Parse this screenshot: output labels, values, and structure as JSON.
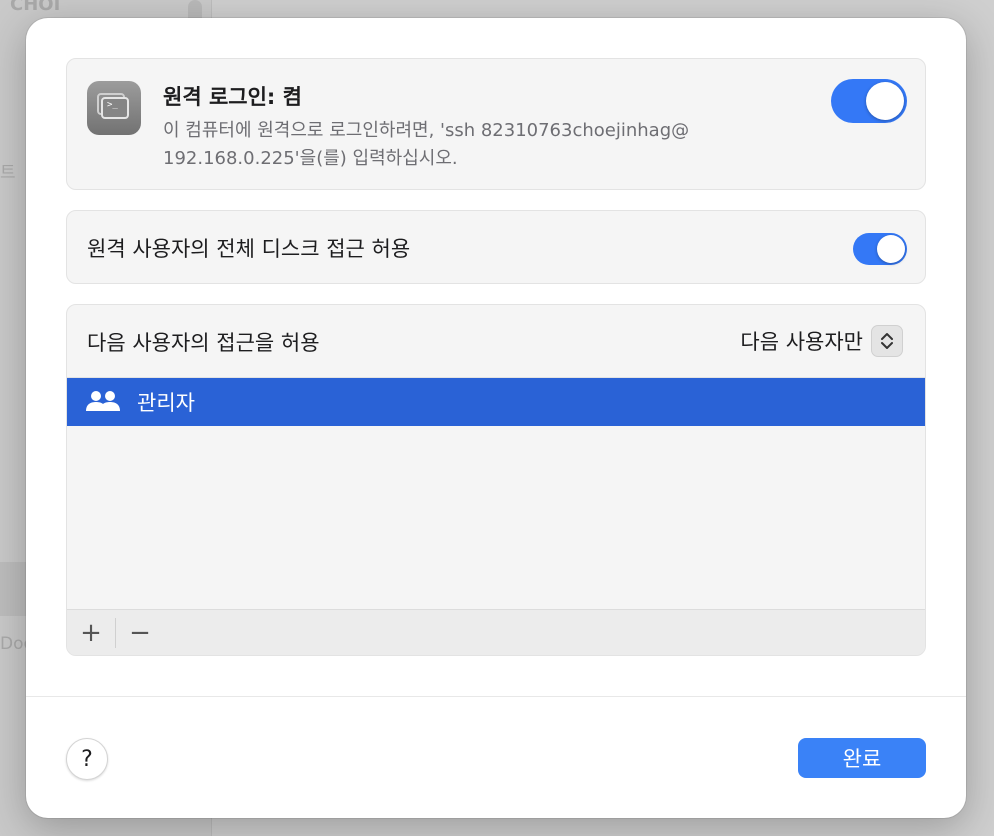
{
  "background": {
    "sidebar_text_1": "CHOI",
    "sidebar_text_2": "트",
    "sidebar_text_3": "Doc"
  },
  "remote_login": {
    "title": "원격 로그인: 켬",
    "description": "이 컴퓨터에 원격으로 로그인하려면, 'ssh 82310763choejinhag@ 192.168.0.225'을(를) 입력하십시오.",
    "enabled": true,
    "icon": "terminal-icon"
  },
  "full_disk": {
    "label": "원격 사용자의 전체 디스크 접근 허용",
    "enabled": true
  },
  "access": {
    "label": "다음 사용자의 접근을 허용",
    "selected_option": "다음 사용자만",
    "users": [
      {
        "name": "관리자",
        "icon": "group-icon",
        "selected": true
      }
    ],
    "add_label": "+",
    "remove_label": "−"
  },
  "footer": {
    "help_label": "?",
    "done_label": "완료"
  },
  "colors": {
    "accent": "#3478f6",
    "selection": "#2a62d6",
    "done_button": "#3a82f7"
  }
}
